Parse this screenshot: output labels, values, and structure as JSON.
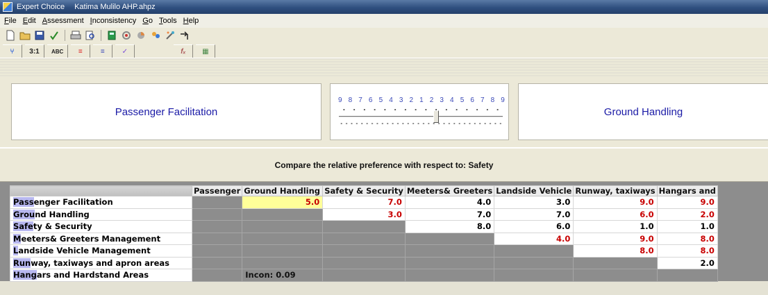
{
  "window": {
    "app_name": "Expert Choice",
    "file_name": "Katima Mulilo AHP.ahpz"
  },
  "menu": [
    {
      "key": "F",
      "rest": "ile"
    },
    {
      "key": "E",
      "rest": "dit"
    },
    {
      "key": "A",
      "rest": "ssessment"
    },
    {
      "key": "I",
      "rest": "nconsistency"
    },
    {
      "key": "G",
      "rest": "o"
    },
    {
      "key": "T",
      "rest": "ools"
    },
    {
      "key": "H",
      "rest": "elp"
    }
  ],
  "mode_tabs": {
    "tree": "⑂",
    "numerical": "3:1",
    "verbal": "ABC",
    "graphical": "≡",
    "questionnaire": "≡",
    "sort": "✓",
    "formula": "fₓ",
    "matrix": "▦"
  },
  "comparison": {
    "left_element": "Passenger Facilitation",
    "right_element": "Ground Handling",
    "scale_numbers": [
      "9",
      "8",
      "7",
      "6",
      "5",
      "4",
      "3",
      "2",
      "1",
      "2",
      "3",
      "4",
      "5",
      "6",
      "7",
      "8",
      "9"
    ],
    "selected_value": 5.0,
    "selected_side": "right",
    "prompt": "Compare the relative preference with respect to: Safety"
  },
  "matrix": {
    "columns": [
      "Passenger",
      "Ground Handling",
      "Safety & Security",
      "Meeters& Greeters",
      "Landside Vehicle",
      "Runway, taxiways",
      "Hangars and"
    ],
    "rows": [
      {
        "hl": "Pass",
        "rest": "enger Facilitation",
        "cells": [
          "",
          "5.0",
          "7.0",
          "4.0",
          "3.0",
          "9.0",
          "9.0"
        ]
      },
      {
        "hl": "Grou",
        "rest": "nd Handling",
        "cells": [
          "",
          "",
          "3.0",
          "7.0",
          "7.0",
          "6.0",
          "2.0"
        ]
      },
      {
        "hl": "Safe",
        "rest": "ty & Security",
        "cells": [
          "",
          "",
          "",
          "8.0",
          "6.0",
          "1.0",
          "1.0"
        ]
      },
      {
        "hl": "M",
        "rest": "eeters& Greeters Management",
        "cells": [
          "",
          "",
          "",
          "",
          "4.0",
          "9.0",
          "8.0"
        ]
      },
      {
        "hl": "L",
        "rest": "andside Vehicle Management",
        "cells": [
          "",
          "",
          "",
          "",
          "",
          "8.0",
          "8.0"
        ]
      },
      {
        "hl": "Run",
        "rest": "way, taxiways and apron areas",
        "cells": [
          "",
          "",
          "",
          "",
          "",
          "",
          "2.0"
        ]
      },
      {
        "hl": "Hang",
        "rest": "ars and Hardstand Areas",
        "cells": [
          "",
          "Incon: 0.09",
          "",
          "",
          "",
          "",
          ""
        ]
      }
    ],
    "colors": {
      "inverted": "#c80000",
      "normal": "#000000",
      "selected": "#ffff99",
      "diagonal": "#8d8d8d"
    }
  }
}
